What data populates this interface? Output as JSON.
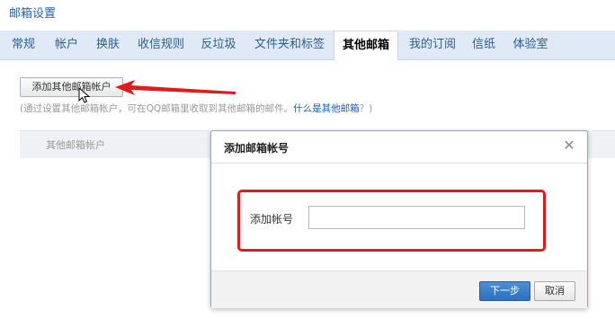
{
  "page": {
    "title": "邮箱设置"
  },
  "tabs": [
    {
      "label": "常规"
    },
    {
      "label": "帐户"
    },
    {
      "label": "换肤"
    },
    {
      "label": "收信规则"
    },
    {
      "label": "反垃圾"
    },
    {
      "label": "文件夹和标签"
    },
    {
      "label": "其他邮箱",
      "active": true
    },
    {
      "label": "我的订阅"
    },
    {
      "label": "信纸"
    },
    {
      "label": "体验室"
    }
  ],
  "main": {
    "add_button_label": "添加其他邮箱帐户",
    "hint_prefix": "(通过设置其他邮箱帐户，可在QQ邮箱里收取到其他邮箱的邮件。",
    "hint_link": "什么是其他邮箱",
    "hint_suffix": "？)",
    "table_header": "其他邮箱帐户"
  },
  "dialog": {
    "title": "添加邮箱帐号",
    "close_icon": "close-icon",
    "field_label": "添加帐号",
    "field_value": "",
    "next_button": "下一步",
    "cancel_button": "取消"
  },
  "annotations": {
    "arrow_color": "#e01b1b",
    "highlight_color": "#e01b1b"
  },
  "colors": {
    "tabbar_bg": "#dfeaf6",
    "primary_button": "#2f6fbf",
    "link": "#1f5da8"
  }
}
